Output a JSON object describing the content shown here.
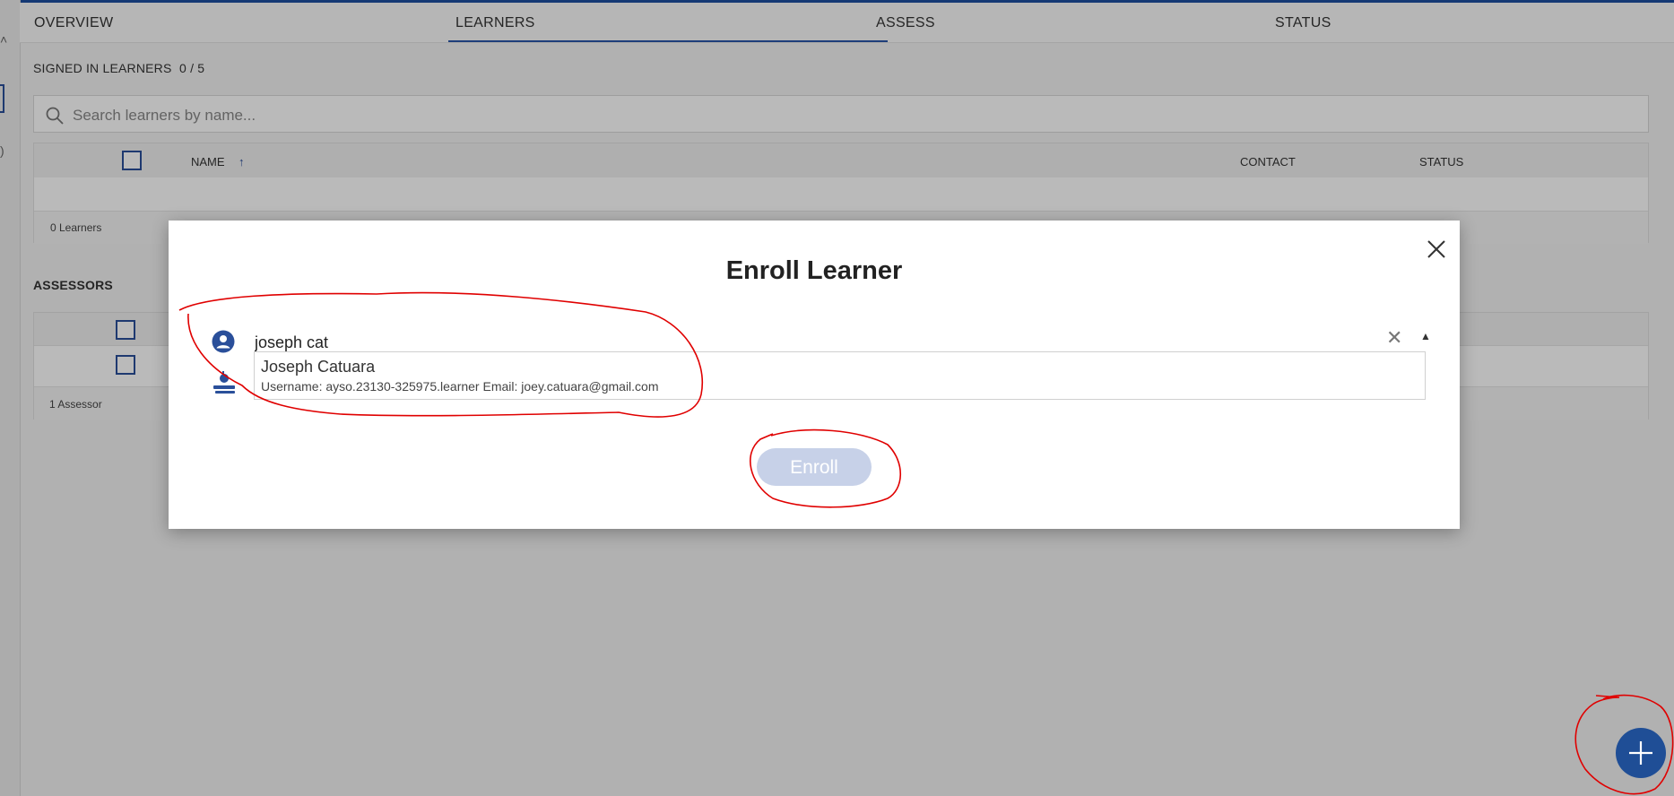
{
  "nav": {
    "tabs": [
      {
        "label": "OVERVIEW"
      },
      {
        "label": "LEARNERS"
      },
      {
        "label": "ASSESS"
      },
      {
        "label": "STATUS"
      }
    ],
    "active_tab": "LEARNERS"
  },
  "learners_section": {
    "title": "SIGNED IN LEARNERS",
    "count": "0 / 5",
    "search_placeholder": "Search learners by name...",
    "columns": {
      "name": "NAME",
      "sort_arrow": "↑",
      "contact": "CONTACT",
      "status": "STATUS"
    },
    "footer": "0 Learners"
  },
  "assessors_section": {
    "title": "ASSESSORS",
    "footer": "1 Assessor"
  },
  "modal": {
    "title": "Enroll Learner",
    "search_value": "joseph cat",
    "suggestion": {
      "name": "Joseph Catuara",
      "details": "Username: ayso.23130-325975.learner Email: joey.catuara@gmail.com"
    },
    "enroll_label": "Enroll"
  },
  "colors": {
    "accent": "#1f4e96",
    "enroll_disabled": "#c7d1e8",
    "annotation": "#e00000"
  },
  "icons": [
    "search-icon",
    "close-icon",
    "user-circle-icon",
    "learner-icon",
    "plus-icon",
    "sort-arrow-icon"
  ]
}
